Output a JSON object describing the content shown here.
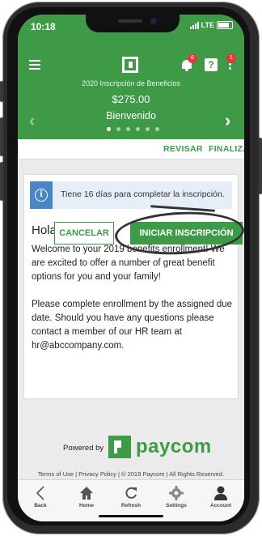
{
  "status_bar": {
    "time": "10:18",
    "carrier": "LTE"
  },
  "header": {
    "notification_count": "8",
    "menu_badge_count": "1",
    "help_label": "?"
  },
  "banner": {
    "title": "2020 Inscripción de Beneficios",
    "amount": "$275.00",
    "welcome": "Bienvenido",
    "prev_glyph": "‹",
    "next_glyph": "›"
  },
  "actions": {
    "review": "REVISAR",
    "finish": "FINALIZAR"
  },
  "notice": {
    "icon_label": "i",
    "text": "Tiene 16 días para completar la inscripción."
  },
  "card": {
    "greeting": "Hola Jane",
    "paragraph1": "Welcome to your 2019 benefits enrollment! We are excited to offer a number of great benefit options for you and your family!",
    "paragraph2": "Please complete enrollment by the assigned due date. Should you have any questions please contact a member of our HR team at hr@abccompany.com.",
    "cancel_label": "CANCELAR",
    "start_label": "INICIAR INSCRIPCIÓN"
  },
  "footer": {
    "powered_by": "Powered by",
    "brand": "paycom",
    "legal": "Terms of Use | Privacy Policy | © 2019 Paycom | All Rights Reserved."
  },
  "tabs": [
    {
      "label": "Back",
      "icon": "back-icon"
    },
    {
      "label": "Home",
      "icon": "home-icon"
    },
    {
      "label": "Refresh",
      "icon": "refresh-icon"
    },
    {
      "label": "Settings",
      "icon": "gear-icon"
    },
    {
      "label": "Account",
      "icon": "account-icon"
    }
  ],
  "colors": {
    "brand_green": "#3e9a47",
    "info_blue": "#4a86c5",
    "badge_red": "#e0393e"
  }
}
